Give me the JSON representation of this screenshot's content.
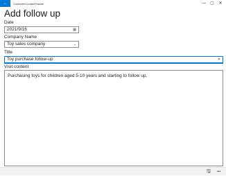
{
  "window": {
    "title": "CustomerContactTracker",
    "back_icon": "back-arrow-icon",
    "controls": [
      "—",
      "▢",
      "✕"
    ]
  },
  "page": {
    "title": "Add follow up"
  },
  "form": {
    "date_label": "Date",
    "date_value": "2021/9/16",
    "company_label": "Company Name",
    "company_value": "Toy sales company",
    "title_label": "Title",
    "title_value": "Toy purchase follow-up",
    "visit_label": "Visit content",
    "visit_value": "Purchasing toys for children aged 5-10 years and starting to follow up."
  },
  "commandbar": {
    "save_icon": "save-icon",
    "more_label": "•••"
  }
}
